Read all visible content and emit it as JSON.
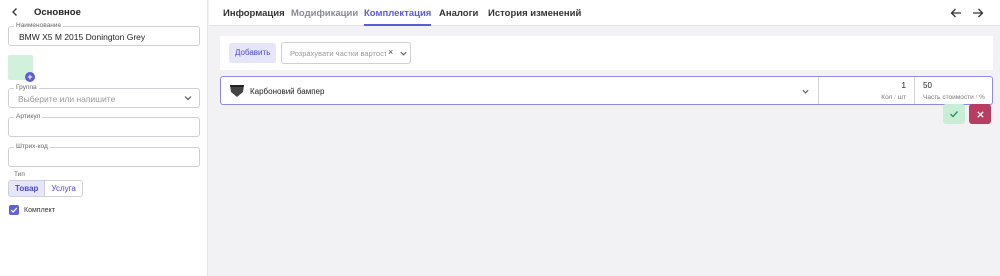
{
  "sidebar": {
    "title": "Основное",
    "name": {
      "label": "Наименование",
      "value": "BMW X5 M 2015 Donington Grey"
    },
    "group": {
      "label": "Группа",
      "placeholder": "Выберите или напишите"
    },
    "article": {
      "label": "Артикул",
      "value": ""
    },
    "barcode": {
      "label": "Штрих-код",
      "value": ""
    },
    "type": {
      "label": "Тип",
      "options": [
        "Товар",
        "Услуга"
      ],
      "selected": "Товар"
    },
    "kit": {
      "label": "Комплект",
      "checked": true
    },
    "add_image_symbol": "+"
  },
  "tabs": [
    {
      "label": "Информация",
      "state": "normal"
    },
    {
      "label": "Модификации",
      "state": "muted"
    },
    {
      "label": "Комплектация",
      "state": "active"
    },
    {
      "label": "Аналоги",
      "state": "normal"
    },
    {
      "label": "История изменений",
      "state": "normal"
    }
  ],
  "toolbar": {
    "add_label": "Добавить",
    "calc_placeholder": "Розрахувати частки вартості",
    "clear_symbol": "×"
  },
  "item": {
    "name": "Карбоновий бампер",
    "quantity": "1",
    "quantity_label": "Кол",
    "quantity_unit": "шт",
    "share": "50",
    "share_label": "Часть стоимости",
    "share_unit": "%"
  },
  "colors": {
    "accent": "#5b5bd6",
    "confirm_bg": "#c9eed6",
    "cancel_bg": "#b93c63",
    "image_placeholder": "#d2f1dc"
  },
  "icons": {
    "back": "chevron-left-icon",
    "nav_back": "arrow-left-icon",
    "nav_forward": "arrow-right-icon",
    "confirm": "check-icon",
    "cancel": "close-icon",
    "item": "bumper-icon"
  }
}
